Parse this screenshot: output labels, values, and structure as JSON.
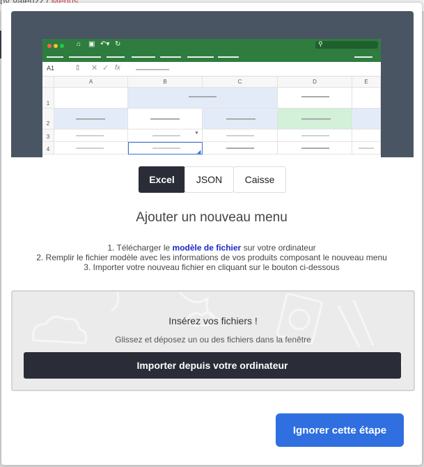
{
  "background": {
    "breadcrumb_prefix": "by Valeuzz",
    "breadcrumb_sep": "/",
    "breadcrumb_current": "Menus"
  },
  "preview": {
    "cell_ref": "A1",
    "fx_label": "fx",
    "columns": [
      "A",
      "B",
      "C",
      "D",
      "E"
    ],
    "rows": [
      "1",
      "2",
      "3",
      "4"
    ]
  },
  "tabs": [
    {
      "label": "Excel",
      "active": true
    },
    {
      "label": "JSON",
      "active": false
    },
    {
      "label": "Caisse",
      "active": false
    }
  ],
  "main": {
    "title": "Ajouter un nouveau menu",
    "step1_pre": "1. Télécharger le ",
    "step1_link": "modèle de fichier",
    "step1_post": " sur votre ordinateur",
    "step2": "2. Remplir le fichier modèle avec les informations de vos produits composant le nouveau menu",
    "step3": "3. Importer votre nouveau fichier en cliquant sur le bouton ci-dessous"
  },
  "dropzone": {
    "title": "Insérez vos fichiers !",
    "subtitle": "Glissez et déposez un ou des fichiers dans la fenêtre",
    "button_label": "Importer depuis votre ordinateur"
  },
  "footer": {
    "skip_label": "Ignorer cette étape"
  },
  "colors": {
    "accent": "#2f6fe0",
    "dark_button": "#2a2d37",
    "excel_green": "#2e7d3f",
    "link": "#1a25c9"
  }
}
